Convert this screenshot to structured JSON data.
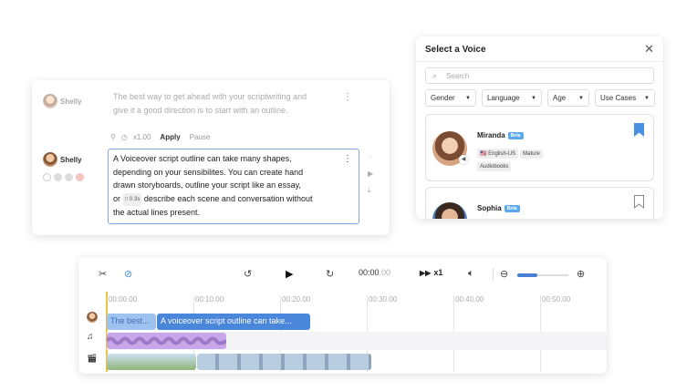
{
  "editor": {
    "row1": {
      "speaker": "Shelly",
      "text_line1": "The best way to get ahead with your scriptwriting and",
      "text_line2": "give it a good direction is to start with an outline."
    },
    "toolbar": {
      "speed": "x1.00",
      "apply": "Apply",
      "pause": "Pause"
    },
    "row2": {
      "speaker": "Shelly",
      "line1": "A Voiceover script outline can take many shapes,",
      "line2": "depending on your sensibilites. You can create hand",
      "line3": "drawn storyboards, outline your script like an essay,",
      "line4_pre": "or",
      "pause_tag": "0.3s",
      "line4_post": "describe each scene and conversation without",
      "line5": "the actual lines present."
    }
  },
  "voice_dialog": {
    "title": "Select a Voice",
    "search_placeholder": "Search",
    "filters": [
      "Gender",
      "Language",
      "Age",
      "Use Cases"
    ],
    "voices": [
      {
        "name": "Miranda",
        "badge": "Beta",
        "tags": [
          "English-US",
          "Mature"
        ],
        "use_case": "Audiobooks",
        "bookmarked": true
      },
      {
        "name": "Sophia",
        "badge": "Beta",
        "bookmarked": false
      }
    ],
    "accent_color": "#4a90e2"
  },
  "timeline": {
    "time_display": "00:00",
    "time_display_faded": ".00",
    "speed_label": "x1",
    "ticks": [
      "00:00.00",
      "00:10.00",
      "00:20.00",
      "00:30.00",
      "00:40.00",
      "00:50.00"
    ],
    "clips": {
      "faded_clip": "The best...",
      "active_clip": "A voiceover script outline can take..."
    },
    "zoom_level": 0.4
  }
}
